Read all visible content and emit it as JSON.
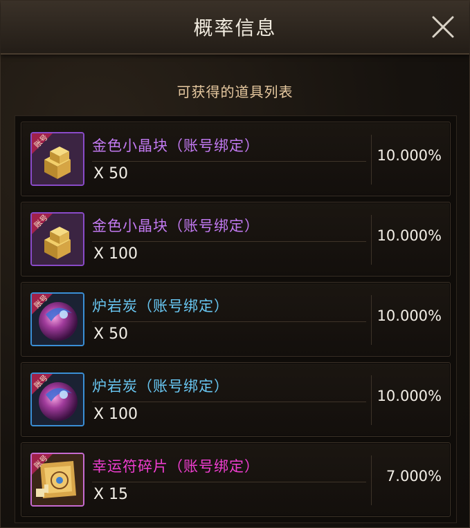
{
  "dialog": {
    "title": "概率信息",
    "subtitle": "可获得的道具列表",
    "close_icon": "close-icon"
  },
  "items": [
    {
      "name": "金色小晶块（账号绑定）",
      "qty": "X 50",
      "prob": "10.000%",
      "rarity_color": "#c27af2",
      "icon": "gold-crystal-icon",
      "badge": "账号"
    },
    {
      "name": "金色小晶块（账号绑定）",
      "qty": "X 100",
      "prob": "10.000%",
      "rarity_color": "#c27af2",
      "icon": "gold-crystal-icon",
      "badge": "账号"
    },
    {
      "name": "炉岩炭（账号绑定）",
      "qty": "X 50",
      "prob": "10.000%",
      "rarity_color": "#69c8f4",
      "icon": "lava-coal-orb-icon",
      "badge": "账号"
    },
    {
      "name": "炉岩炭（账号绑定）",
      "qty": "X 100",
      "prob": "10.000%",
      "rarity_color": "#69c8f4",
      "icon": "lava-coal-orb-icon",
      "badge": "账号"
    },
    {
      "name": "幸运符碎片（账号绑定）",
      "qty": "X 15",
      "prob": "7.000%",
      "rarity_color": "#f13ed2",
      "icon": "lucky-charm-fragment-icon",
      "badge": "账号"
    }
  ]
}
